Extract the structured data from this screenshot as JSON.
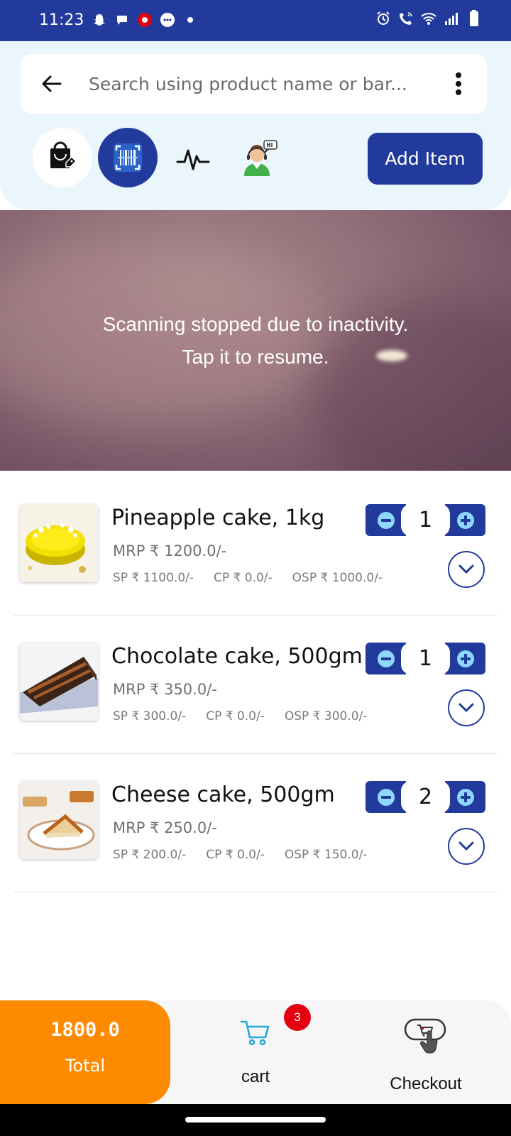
{
  "status_bar": {
    "time": "11:23",
    "left_icons": [
      "snapchat-icon",
      "chat-bubble-icon",
      "notification-icon",
      "messages-icon",
      "dot-icon"
    ],
    "right_icons": [
      "alarm-icon",
      "wifi-call-icon",
      "wifi-icon",
      "signal-icon",
      "battery-icon"
    ],
    "background": "#213a9c"
  },
  "search": {
    "placeholder": "Search using product name or bar..."
  },
  "toolbar": {
    "icons": [
      "shopping-bag-icon",
      "barcode-scanner-icon",
      "pulse-icon",
      "support-agent-icon"
    ],
    "add_item_label": "Add Item"
  },
  "scanner": {
    "message_line1": "Scanning stopped due to inactivity.",
    "message_line2": "Tap it to resume."
  },
  "products": [
    {
      "name": "Pineapple cake, 1kg",
      "mrp": "MRP ₹ 1200.0/-",
      "sp": "SP ₹ 1100.0/-",
      "cp": "CP ₹ 0.0/-",
      "osp": "OSP ₹ 1000.0/-",
      "quantity": "1"
    },
    {
      "name": "Chocolate cake, 500gm",
      "mrp": "MRP ₹ 350.0/-",
      "sp": "SP ₹ 300.0/-",
      "cp": "CP ₹ 0.0/-",
      "osp": "OSP ₹ 300.0/-",
      "quantity": "1"
    },
    {
      "name": "Cheese cake, 500gm",
      "mrp": "MRP ₹ 250.0/-",
      "sp": "SP ₹ 200.0/-",
      "cp": "CP ₹ 0.0/-",
      "osp": "OSP ₹ 150.0/-",
      "quantity": "2"
    }
  ],
  "footer": {
    "total_value": "1800.0",
    "total_label": "Total",
    "cart_label": "cart",
    "cart_count": "3",
    "checkout_label": "Checkout"
  },
  "colors": {
    "primary": "#213a9c",
    "accent": "#fe8a00",
    "badge": "#e3000f",
    "header_bg": "#eaf6fc"
  }
}
